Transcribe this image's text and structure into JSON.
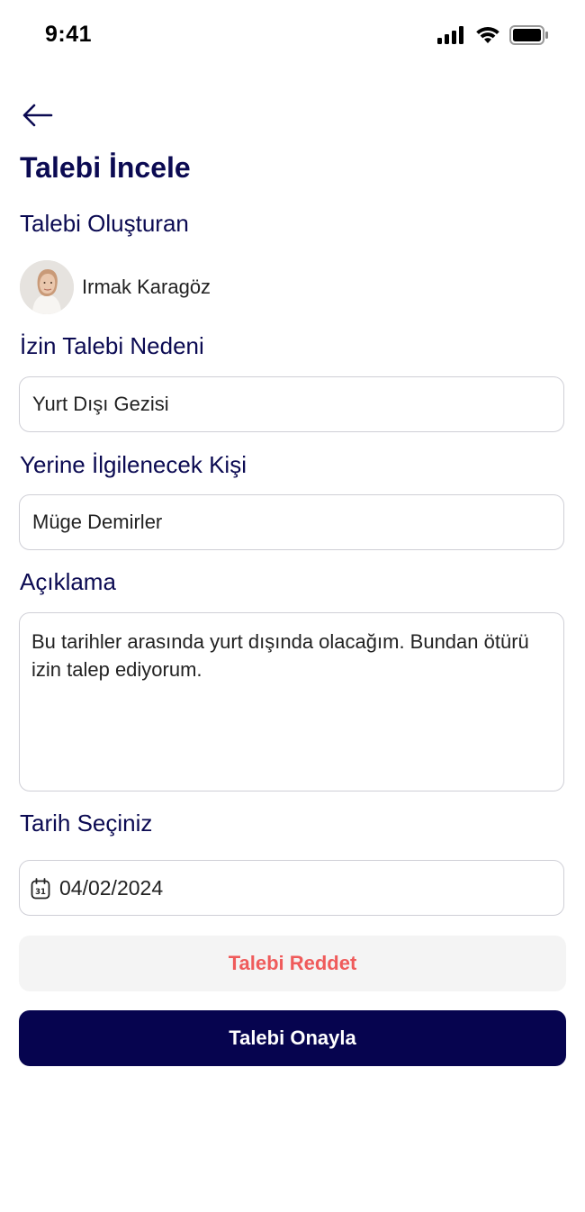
{
  "status_bar": {
    "time": "9:41"
  },
  "header": {
    "title": "Talebi İncele"
  },
  "creator": {
    "label": "Talebi Oluşturan",
    "name": "Irmak Karagöz"
  },
  "reason": {
    "label": "İzin Talebi Nedeni",
    "value": "Yurt Dışı Gezisi"
  },
  "substitute": {
    "label": "Yerine İlgilenecek Kişi",
    "value": "Müge Demirler"
  },
  "description": {
    "label": "Açıklama",
    "value": "Bu tarihler arasında yurt dışında olacağım. Bundan ötürü izin talep ediyorum."
  },
  "date": {
    "label": "Tarih Seçiniz",
    "value": "04/02/2024",
    "icon": "calendar-icon",
    "icon_text": "31"
  },
  "actions": {
    "reject_label": "Talebi Reddet",
    "approve_label": "Talebi Onayla"
  },
  "colors": {
    "primary": "#06044f",
    "heading": "#0b0a52",
    "danger": "#ef5b5b",
    "field_border": "#cfcfd6",
    "secondary_bg": "#f4f4f4"
  }
}
